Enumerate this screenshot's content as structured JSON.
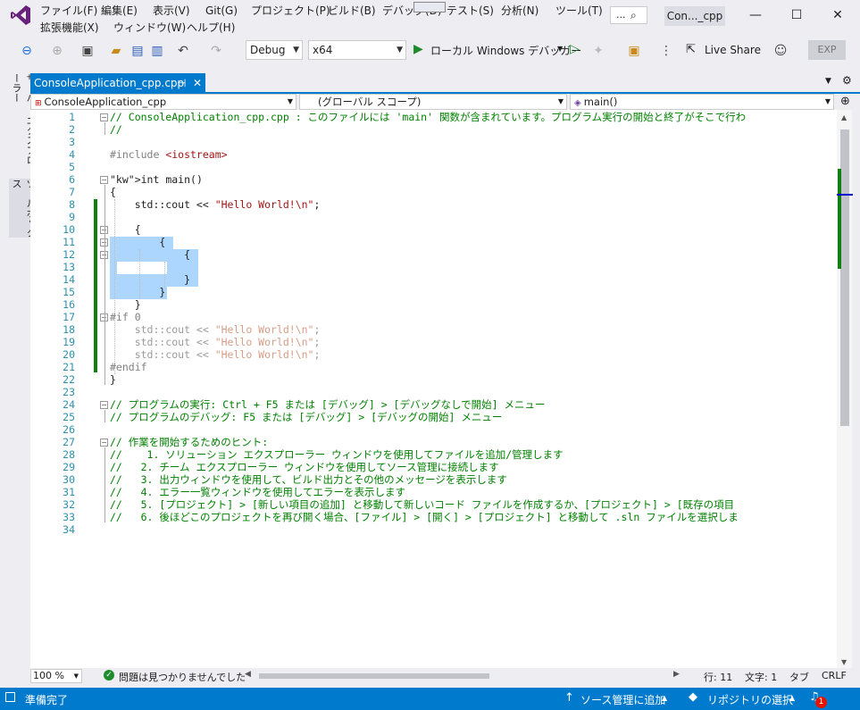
{
  "menu": {
    "row1": [
      "ファイル(F)",
      "編集(E)",
      "表示(V)",
      "Git(G)",
      "プロジェクト(P)",
      "ビルド(B)",
      "デバッグ(D)",
      "テスト(S)",
      "分析(N)",
      "ツール(T)"
    ],
    "row2": [
      "拡張機能(X)",
      "ウィンドウ(W)",
      "ヘルプ(H)"
    ],
    "search_label": "...",
    "title": "Con..._cpp"
  },
  "window": {
    "minimize": "—",
    "maximize": "☐",
    "close": "✕"
  },
  "toolbar": {
    "config": "Debug",
    "platform": "x64",
    "run_label": "ローカル Windows デバッガー",
    "live_share": "Live Share",
    "exp": "EXP"
  },
  "sidebar": {
    "server_explorer": "サーバー エクスプローラー",
    "toolbox": "ツールボックス"
  },
  "tab": {
    "name": "ConsoleApplication_cpp.cpp",
    "pin": "⊣",
    "close": "✕"
  },
  "navbar": {
    "project": "ConsoleApplication_cpp",
    "scope": "(グローバル スコープ)",
    "member": "main()"
  },
  "editor": {
    "lines": [
      "// ConsoleApplication_cpp.cpp : このファイルには 'main' 関数が含まれています。プログラム実行の開始と終了がそこで行わ",
      "//",
      "",
      "#include <iostream>",
      "",
      "int main()",
      "{",
      "    std::cout << \"Hello World!\\n\";",
      "",
      "    {",
      "        {",
      "            {",
      "",
      "            }",
      "        }",
      "    }",
      "#if 0",
      "    std::cout << \"Hello World!\\n\";",
      "    std::cout << \"Hello World!\\n\";",
      "    std::cout << \"Hello World!\\n\";",
      "#endif",
      "}",
      "",
      "// プログラムの実行: Ctrl + F5 または [デバッグ] > [デバッグなしで開始] メニュー",
      "// プログラムのデバッグ: F5 または [デバッグ] > [デバッグの開始] メニュー",
      "",
      "// 作業を開始するためのヒント:",
      "//    1. ソリューション エクスプローラー ウィンドウを使用してファイルを追加/管理します",
      "//   2. チーム エクスプローラー ウィンドウを使用してソース管理に接続します",
      "//   3. 出力ウィンドウを使用して、ビルド出力とその他のメッセージを表示します",
      "//   4. エラー一覧ウィンドウを使用してエラーを表示します",
      "//   5. [プロジェクト] > [新しい項目の追加] と移動して新しいコード ファイルを作成するか、[プロジェクト] > [既存の項目",
      "//   6. 後ほどこのプロジェクトを再び開く場合、[ファイル] > [開く] > [プロジェクト] と移動して .sln ファイルを選択しま",
      ""
    ]
  },
  "bottom": {
    "zoom": "100 %",
    "issues": "問題は見つかりませんでした",
    "line": "行: 11",
    "char": "文字: 1",
    "tab_mode": "タブ",
    "eol": "CRLF"
  },
  "status": {
    "ready": "準備完了",
    "add_source": "ソース管理に追加",
    "select_repo": "リポジトリの選択",
    "notif_count": "1"
  },
  "colors": {
    "accent": "#007acc",
    "selection": "#add6ff",
    "changebar": "#108010"
  }
}
